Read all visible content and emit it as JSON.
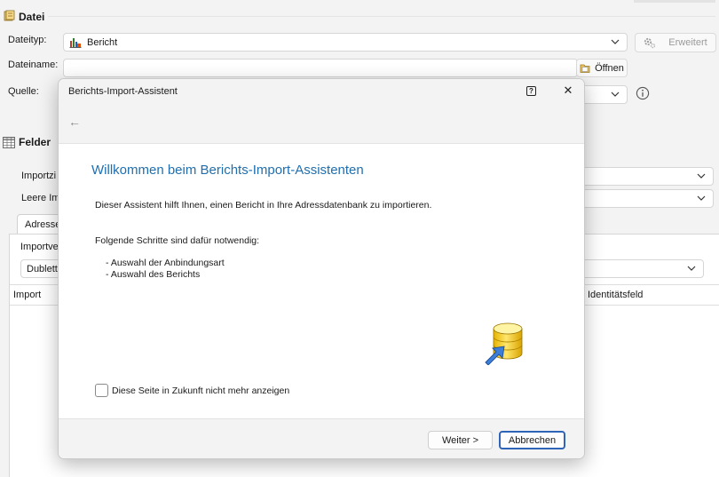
{
  "datei": {
    "section_title": "Datei",
    "dateityp_label": "Dateityp:",
    "dateityp_value": "Bericht",
    "erweitert_label": "Erweitert",
    "dateiname_label": "Dateiname:",
    "dateiname_value": "",
    "oeffnen_label": "Öffnen",
    "quelle_label": "Quelle:"
  },
  "felder": {
    "section_title": "Felder",
    "importziel_label_partial": "Importzi",
    "leere_label_partial": "Leere Im",
    "tab_partial": "Adresse",
    "importvorgang_partial": "Importve",
    "dublette_partial": "Dublett",
    "col_import": "Import",
    "col_identitaetsfeld": "Identitätsfeld"
  },
  "dialog": {
    "title": "Berichts-Import-Assistent",
    "heading": "Willkommen beim Berichts-Import-Assistenten",
    "intro": "Dieser Assistent hilft Ihnen, einen Bericht in Ihre Adressdatenbank zu importieren.",
    "steps_intro": "Folgende Schritte sind dafür notwendig:",
    "steps": [
      "- Auswahl der Anbindungsart",
      "- Auswahl des Berichts"
    ],
    "checkbox_label": "Diese Seite in Zukunft nicht mehr anzeigen",
    "next_button": "Weiter >",
    "cancel_button": "Abbrechen",
    "help_glyph": "?",
    "close_glyph": "✕",
    "back_glyph": "←"
  },
  "colors": {
    "accent": "#2f65b8",
    "heading": "#1f6fb0",
    "database_yellow": "#f3c900",
    "arrow_blue": "#3d7ed8"
  }
}
